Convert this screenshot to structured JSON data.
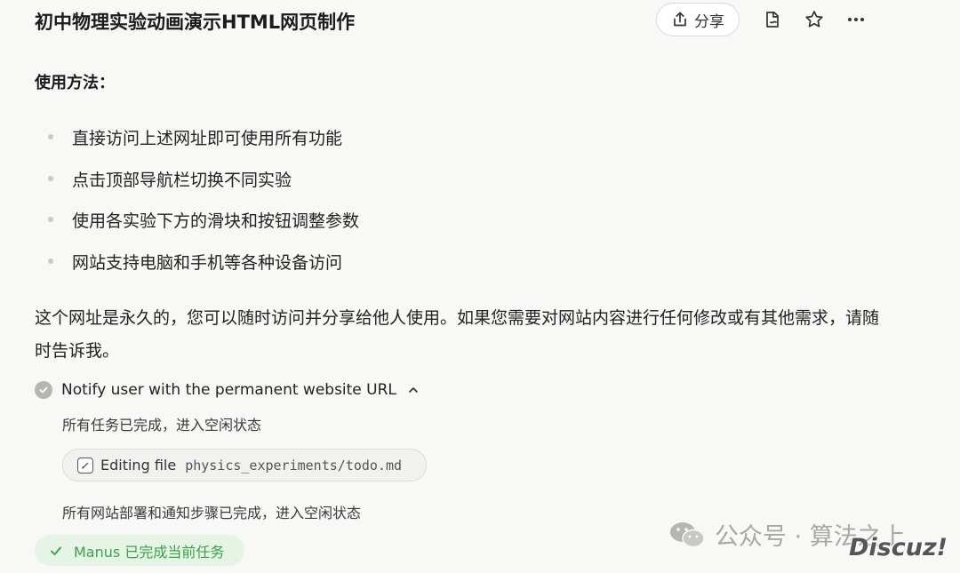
{
  "header": {
    "title": "初中物理实验动画演示HTML网页制作",
    "share_label": "分享",
    "icons": [
      "share-upload-icon",
      "document-icon",
      "star-icon",
      "more-icon"
    ]
  },
  "usage": {
    "heading": "使用方法：",
    "items": [
      "直接访问上述网址即可使用所有功能",
      "点击顶部导航栏切换不同实验",
      "使用各实验下方的滑块和按钮调整参数",
      "网站支持电脑和手机等各种设备访问"
    ]
  },
  "message": "这个网址是永久的，您可以随时访问并分享给他人使用。如果您需要对网站内容进行任何修改或有其他需求，请随时告诉我。",
  "step": {
    "title": "Notify user with the permanent website URL",
    "status_text_1": "所有任务已完成，进入空闲状态",
    "file_action": "Editing file",
    "file_path": "physics_experiments/todo.md",
    "status_text_2": "所有网站部署和通知步骤已完成，进入空闲状态"
  },
  "completion": {
    "label": "Manus 已完成当前任务"
  },
  "watermark": {
    "text": "公众号 · 算法之上",
    "brand": "Discuz!"
  },
  "colors": {
    "background": "#f8f8f7",
    "success_text": "#3aa24a",
    "success_bg": "#e6f4e6"
  }
}
